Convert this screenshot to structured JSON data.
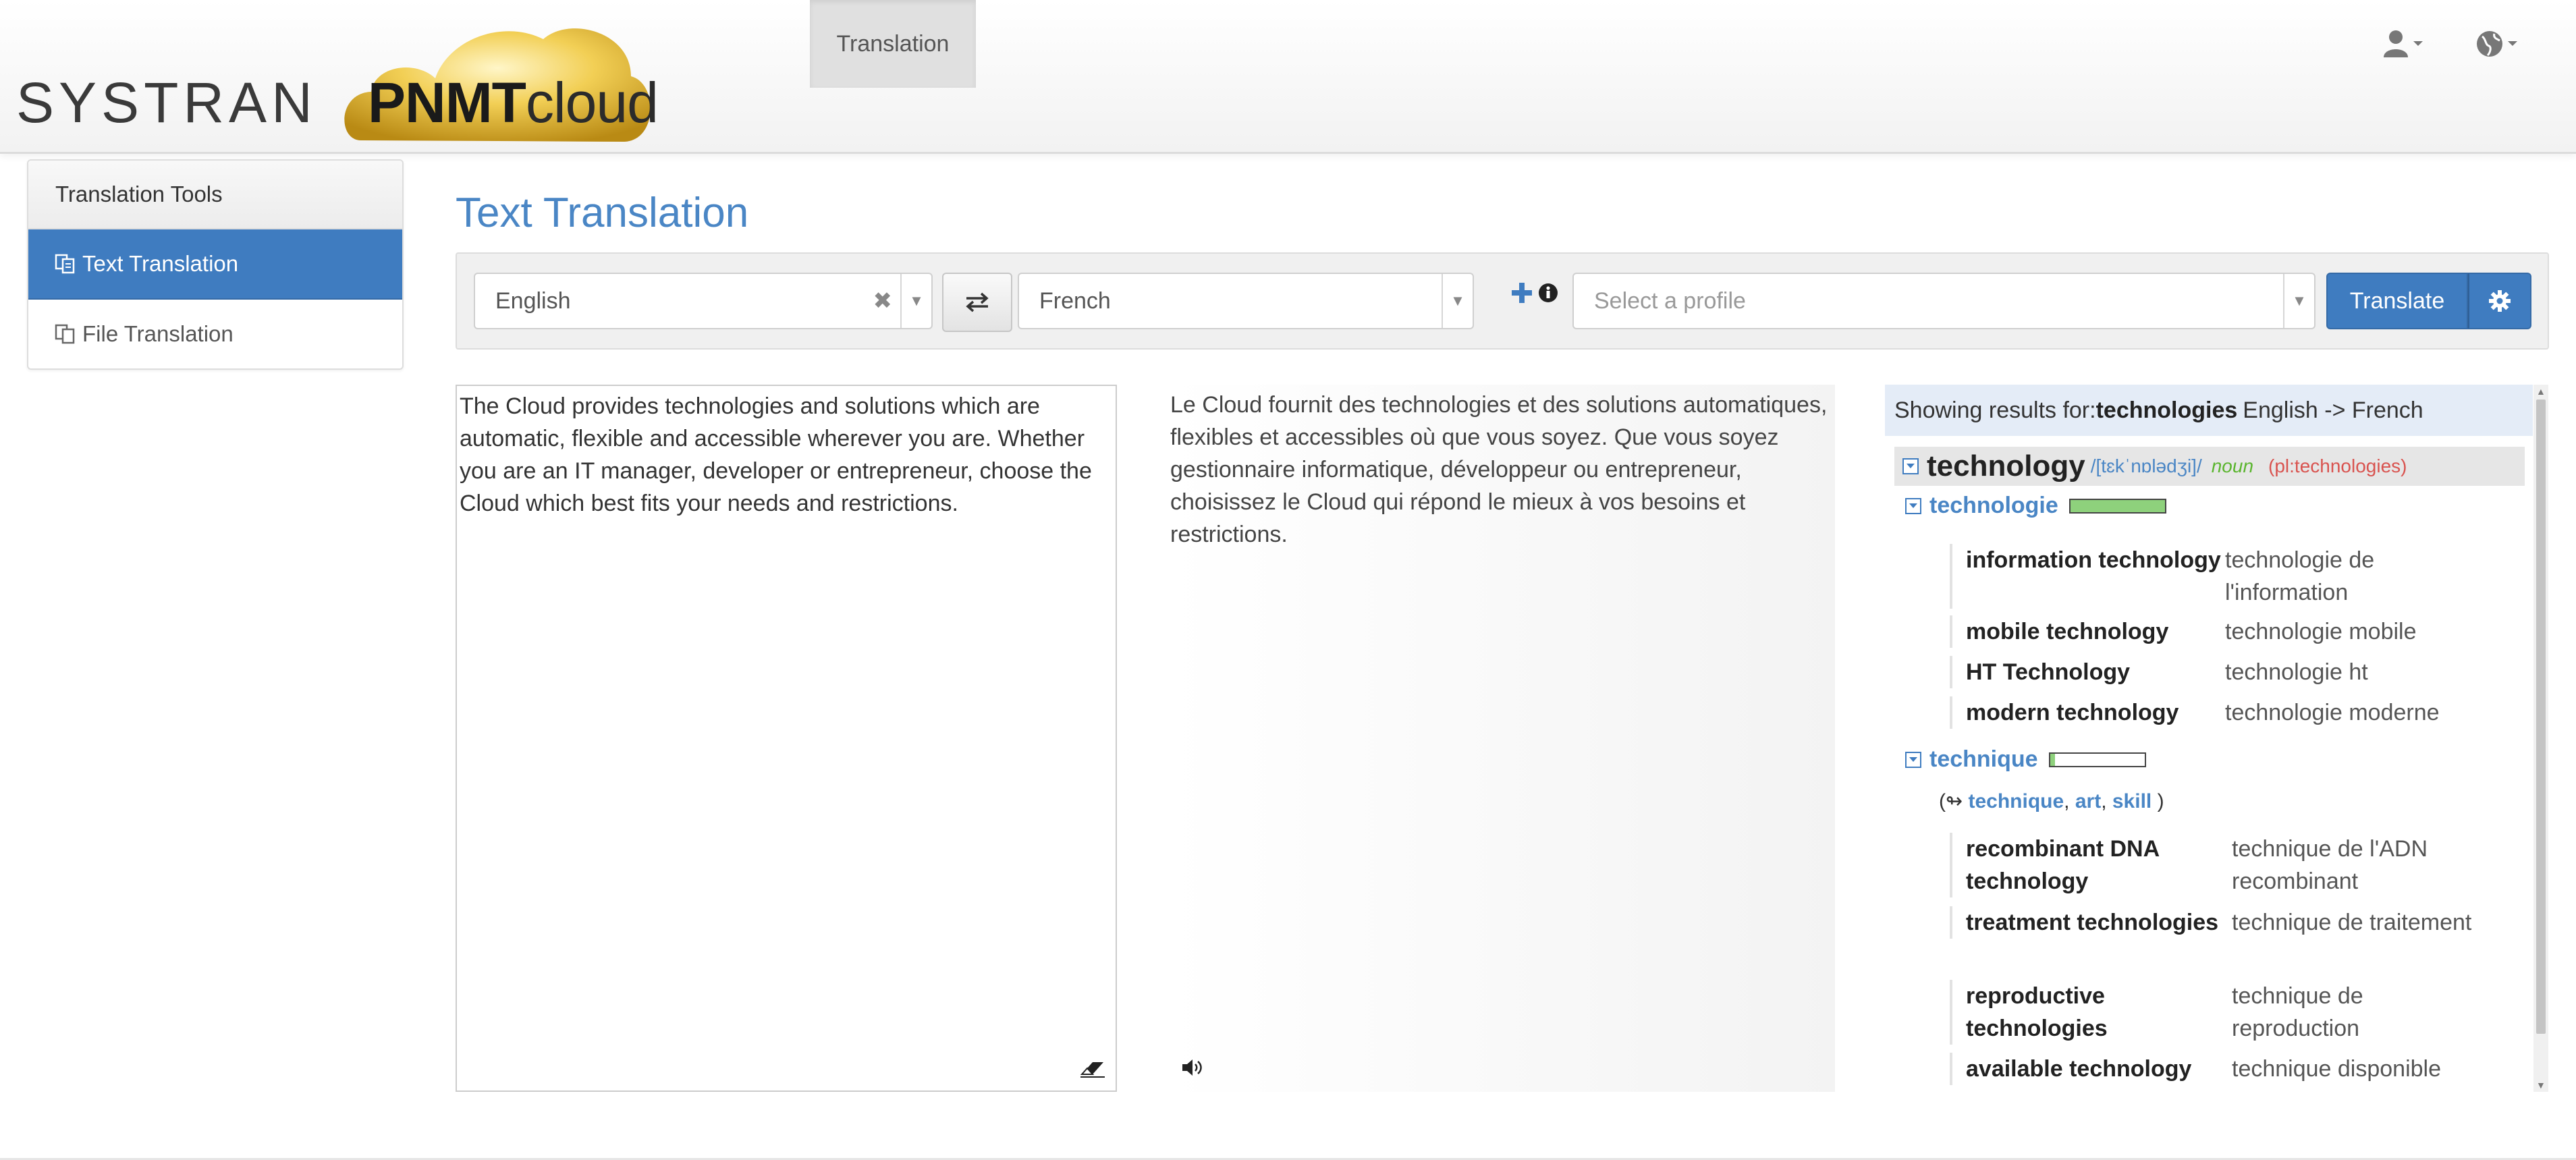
{
  "navbar": {
    "logo_systran": "SYSTRAN",
    "logo_pnmt": "PNMT",
    "logo_cloud": "cloud",
    "tab_translation": "Translation",
    "user_icon": "user-icon",
    "globe_icon": "globe-icon"
  },
  "sidebar": {
    "title": "Translation Tools",
    "items": [
      {
        "label": "Text Translation",
        "icon": "text-translate-icon",
        "active": true
      },
      {
        "label": "File Translation",
        "icon": "file-translate-icon",
        "active": false
      }
    ]
  },
  "main": {
    "title": "Text Translation",
    "source_lang": "English",
    "target_lang": "French",
    "profile_placeholder": "Select a profile",
    "translate_label": "Translate",
    "source_text": "The Cloud provides technologies and solutions which are automatic, flexible and accessible wherever you are. Whether you are an IT manager, developer or entrepreneur, choose the Cloud which best fits your needs and restrictions.",
    "target_text": "Le Cloud fournit des technologies et des solutions automatiques, flexibles et accessibles où que vous soyez. Que vous soyez gestionnaire informatique, développeur ou entrepreneur, choisissez le Cloud qui répond le mieux à vos besoins et restrictions."
  },
  "dictionary": {
    "header_prefix": "Showing results for:",
    "header_word": "technologies",
    "header_direction": "English -> French",
    "entry_word": "technology",
    "phonetic": "/[tɛkˈnɒlədʒi]/",
    "pos": "noun",
    "plural": "(pl:technologies)",
    "senses": [
      {
        "word": "technologie",
        "frequency": 1.0,
        "examples": [
          {
            "src": "information technology",
            "tgt": "technologie de l'information"
          },
          {
            "src": "mobile technology",
            "tgt": "technologie mobile"
          },
          {
            "src": "HT Technology",
            "tgt": "technologie ht"
          },
          {
            "src": "modern technology",
            "tgt": "technologie moderne"
          }
        ]
      },
      {
        "word": "technique",
        "frequency": 0.05,
        "synonyms_open": "(",
        "synonyms_arrow": "↬",
        "synonyms": [
          "technique",
          "art",
          "skill"
        ],
        "synonyms_close": ")",
        "examples": [
          {
            "src": "recombinant DNA technology",
            "tgt": "technique de l'ADN recombinant"
          },
          {
            "src": "treatment technologies",
            "tgt": "technique de traitement"
          },
          {
            "src": "reproductive technologies",
            "tgt": "technique de reproduction"
          },
          {
            "src": "available technology",
            "tgt": "technique disponible"
          }
        ]
      }
    ]
  },
  "colors": {
    "accent": "#3f7cc0",
    "title_blue": "#4a86c5",
    "freq_fill": "#8ed17c",
    "pos_green": "#5ab52e",
    "plural_red": "#d9534f"
  }
}
